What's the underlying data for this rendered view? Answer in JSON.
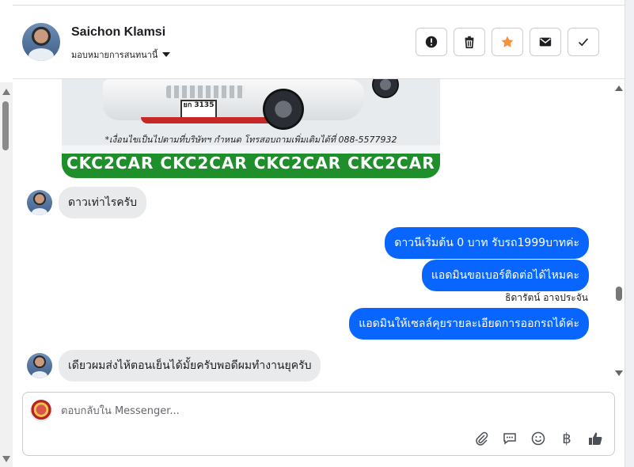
{
  "header": {
    "name": "Saichon Klamsi",
    "assign_label": "มอบหมายการสนทนานี้",
    "actions": [
      {
        "icon": "alert-circle-icon",
        "label": "Mark as spam"
      },
      {
        "icon": "trash-icon",
        "label": "Delete"
      },
      {
        "icon": "star-icon",
        "label": "Star",
        "color": "#f7923b"
      },
      {
        "icon": "envelope-icon",
        "label": "Mark as unread"
      },
      {
        "icon": "check-icon",
        "label": "Mark as done"
      }
    ]
  },
  "image_message": {
    "plate_line1": "ยก 3135",
    "notice": "*เงื่อนไขเป็นไปตามที่บริษัทฯ กำหนด โทรสอบถามเพิ่มเติมได้ที่ 088-5577932",
    "banner": "CKC2CAR CKC2CAR CKC2CAR CKC2CAR CKC2"
  },
  "messages": [
    {
      "id": "m1",
      "direction": "in",
      "text": "ดาวเท่าไรครับ"
    },
    {
      "id": "m2",
      "direction": "out",
      "text": "ดาวนีเริ่มต้น 0 บาท รับรถ1999บาทค่ะ"
    },
    {
      "id": "m3",
      "direction": "out",
      "text": "แอดมินขอเบอร์ติดต่อได้ไหมคะ"
    },
    {
      "id": "m4",
      "direction": "out",
      "text": "แอดมินให้เซลล์คุยรายละเอียดการออกรถได้ค่ะ",
      "sender": "ธิดารัตน์ อาจประจัน"
    },
    {
      "id": "m5",
      "direction": "in",
      "text": "เดียวผมส่งไห้ตอนเย็นได้มั้ยครับพอดีผมทำงานยุครับ"
    }
  ],
  "composer": {
    "placeholder": "ตอบกลับใน Messenger...",
    "tools": [
      "paperclip-icon",
      "saved-reply-icon",
      "emoji-icon",
      "baht-icon",
      "thumbs-up-icon"
    ],
    "baht_symbol": "฿"
  },
  "colors": {
    "outgoing_bubble": "#0866ff",
    "incoming_bubble": "#e9eaec",
    "star": "#f7923b"
  }
}
